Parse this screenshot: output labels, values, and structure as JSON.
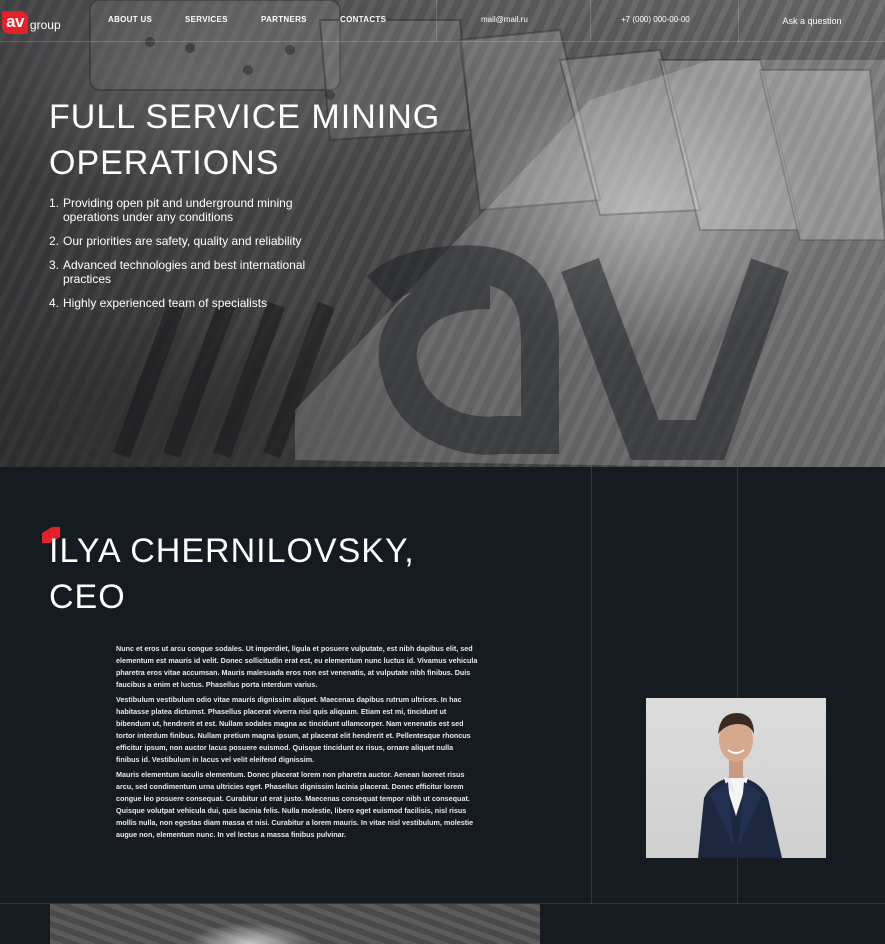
{
  "nav": {
    "logo_av": "av",
    "logo_group": "group",
    "links": [
      "ABOUT US",
      "SERVICES",
      "PARTNERS",
      "CONTACTS"
    ],
    "email": "mail@mail.ru",
    "phone": "+7 (000) 000-00-00",
    "ask_button": "Ask a question"
  },
  "hero": {
    "title": "FULL SERVICE MINING OPERATIONS",
    "items": [
      {
        "num": "1.",
        "text": "Providing open pit and underground mining operations under any conditions"
      },
      {
        "num": "2.",
        "text": "Our priorities are safety, quality and reliability"
      },
      {
        "num": "3.",
        "text": "Advanced technologies and best international practices"
      },
      {
        "num": "4.",
        "text": "Highly experienced team of specialists"
      }
    ]
  },
  "ceo": {
    "name": "ILYA CHERNILOVSKY, CEO",
    "paragraphs": [
      "Nunc et eros ut arcu congue sodales. Ut imperdiet, ligula et posuere vulputate, est nibh dapibus elit, sed elementum est mauris id velit. Donec sollicitudin erat est, eu elementum nunc luctus id. Vivamus vehicula pharetra eros vitae accumsan. Mauris malesuada eros non est venenatis, at vulputate nibh finibus. Duis faucibus a enim et luctus. Phasellus porta interdum varius.",
      "Vestibulum vestibulum odio vitae mauris dignissim aliquet. Maecenas dapibus rutrum ultrices. In hac habitasse platea dictumst. Phasellus placerat viverra nisi quis aliquam. Etiam est mi, tincidunt ut bibendum ut, hendrerit et est. Nullam sodales magna ac tincidunt ullamcorper. Nam venenatis est sed tortor interdum finibus. Nullam pretium magna ipsum, at placerat elit hendrerit et. Pellentesque rhoncus efficitur ipsum, non auctor lacus posuere euismod. Quisque tincidunt ex risus, ornare aliquet nulla finibus id. Vestibulum in lacus vel velit eleifend dignissim.",
      "Mauris elementum iaculis elementum. Donec placerat lorem non pharetra auctor. Aenean laoreet risus arcu, sed condimentum urna ultricies eget. Phasellus dignissim lacinia placerat. Donec efficitur lorem congue leo posuere consequat. Curabitur ut erat justo. Maecenas consequat tempor nibh ut consequat. Quisque volutpat vehicula dui, quis lacinia felis. Nulla molestie, libero eget euismod facilisis, nisl risus mollis nulla, non egestas diam massa et nisi. Curabitur a lorem mauris. In vitae nisl vestibulum, molestie augue non, elementum nunc. In vel lectus a massa finibus pulvinar."
    ]
  },
  "colors": {
    "brand_red": "#e4202a",
    "background_dark": "#161b22"
  }
}
